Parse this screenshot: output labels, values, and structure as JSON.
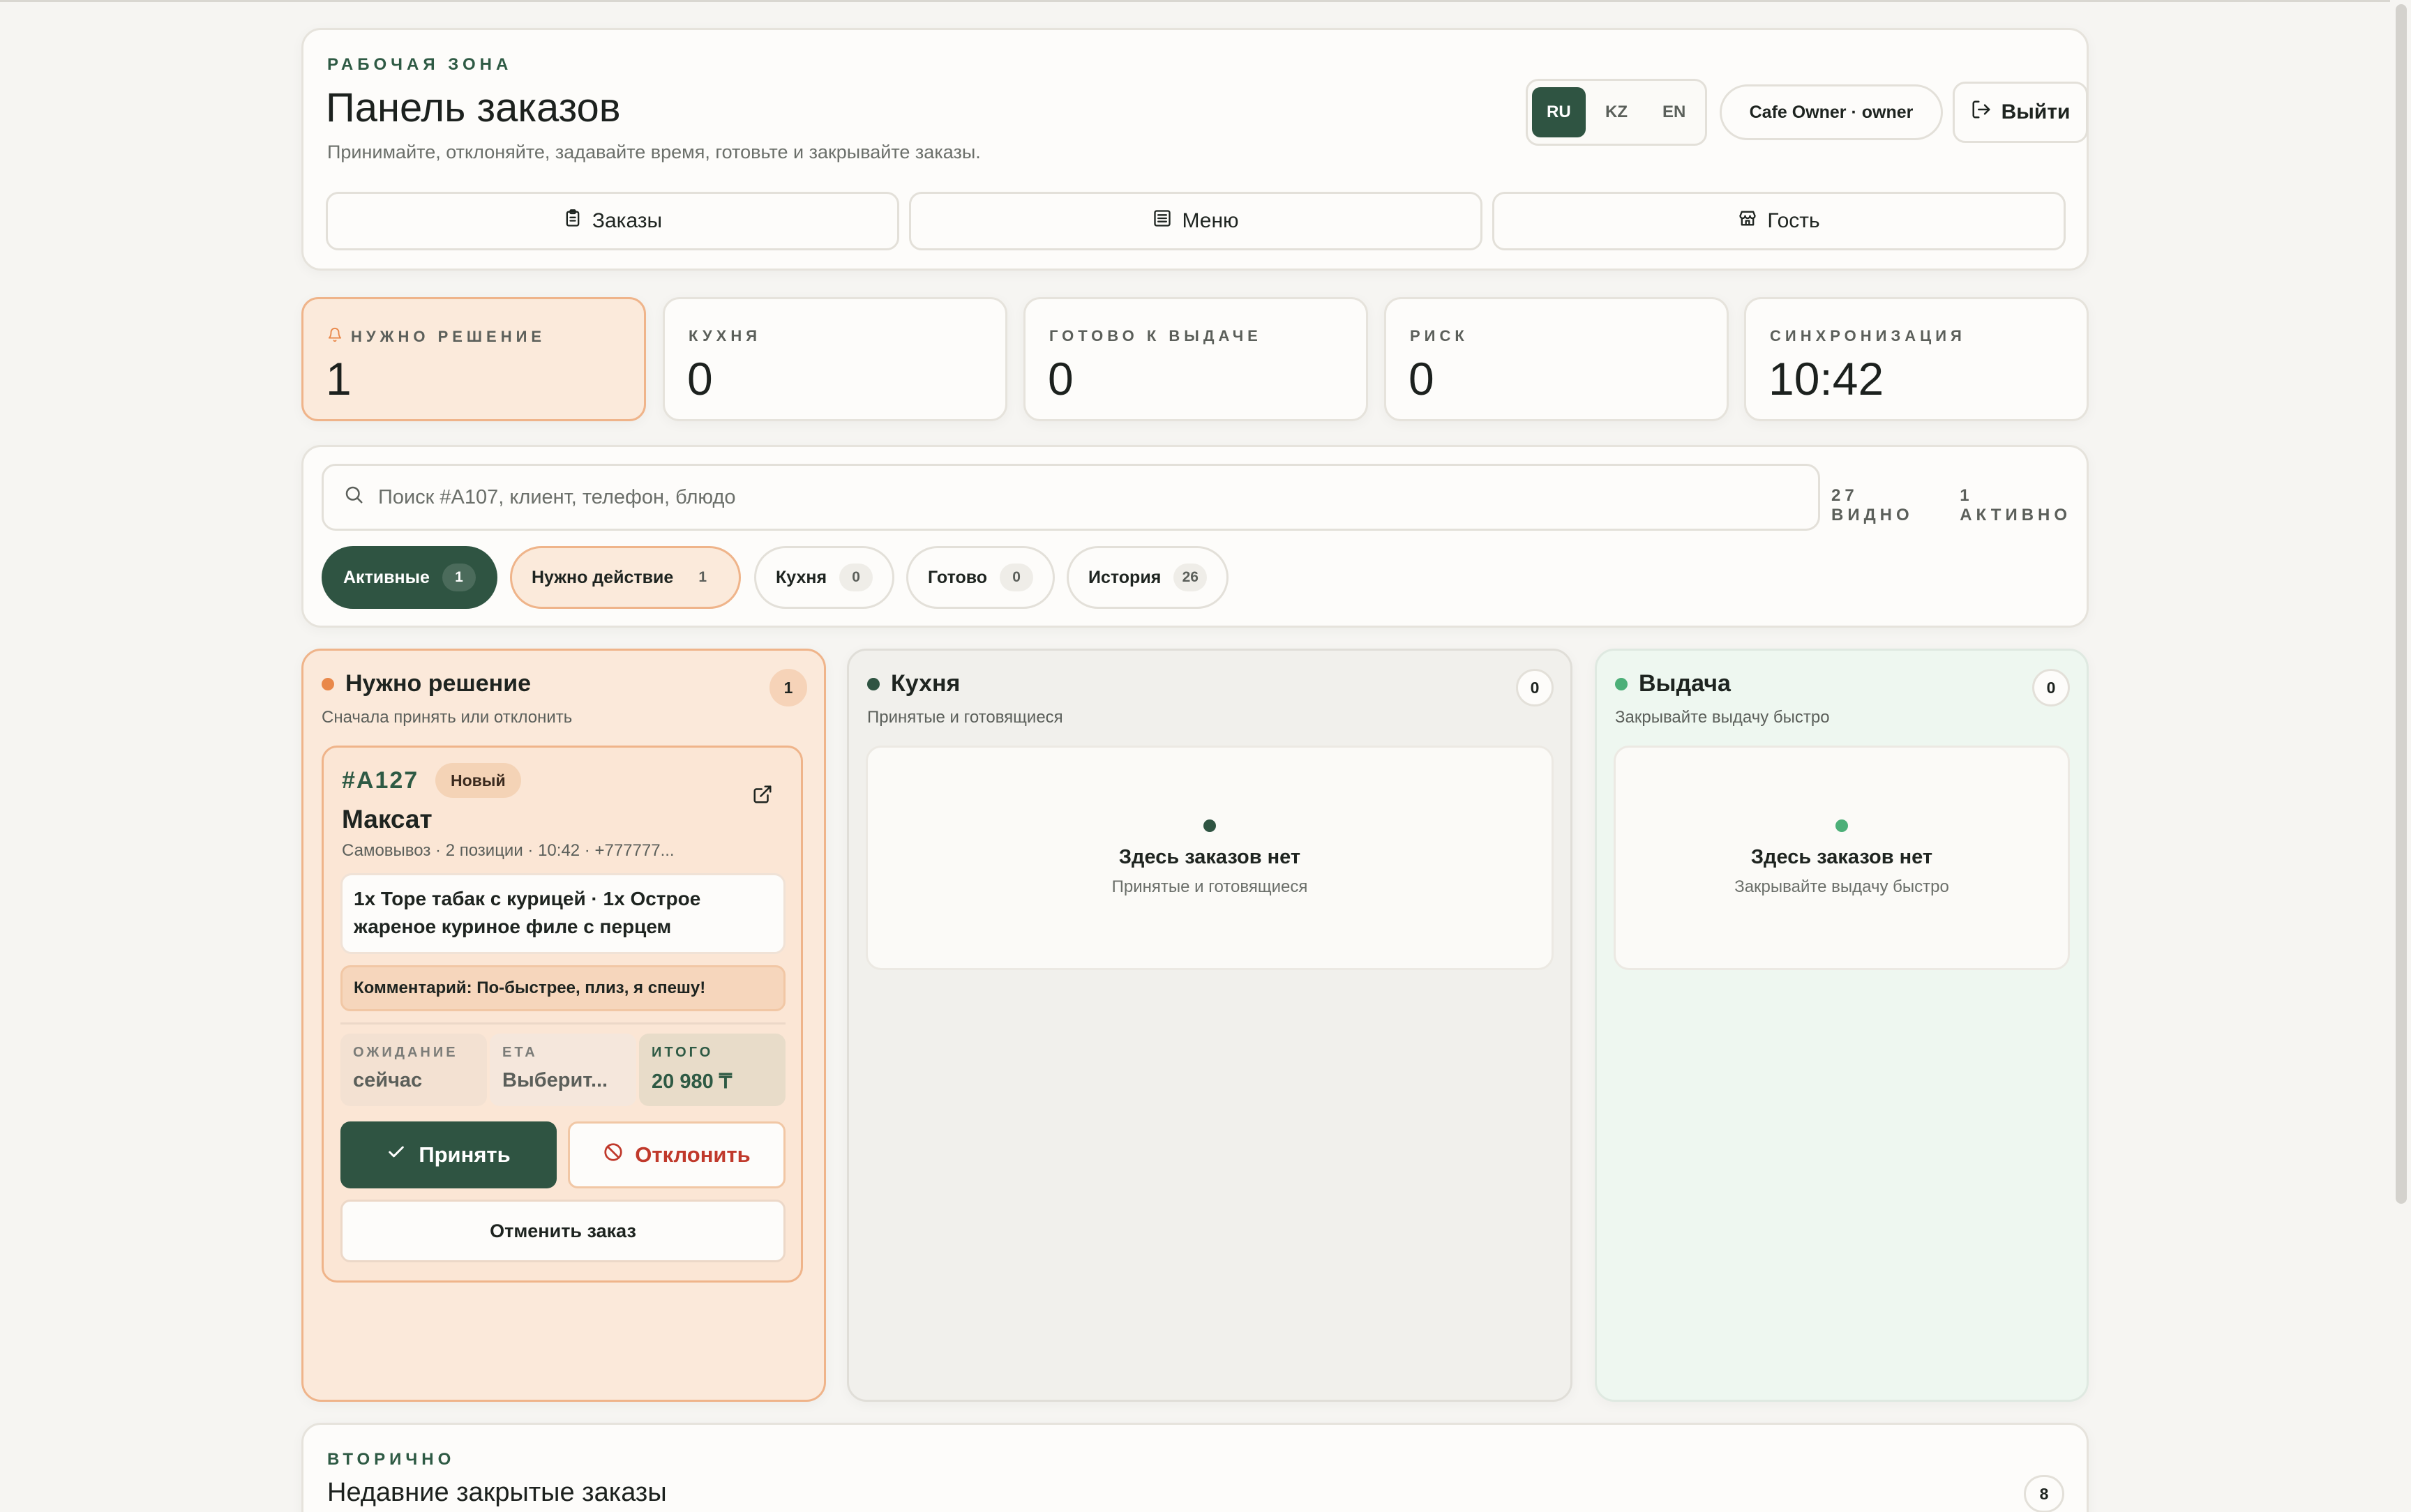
{
  "header": {
    "kicker": "РАБОЧАЯ ЗОНА",
    "title": "Панель заказов",
    "subtitle": "Принимайте, отклоняйте, задавайте время, готовьте и закрывайте заказы.",
    "languages": [
      "RU",
      "KZ",
      "EN"
    ],
    "active_language": "RU",
    "user": "Cafe Owner · owner",
    "logout_label": "Выйти",
    "nav": [
      {
        "label": "Заказы",
        "icon": "clipboard-icon"
      },
      {
        "label": "Меню",
        "icon": "list-icon"
      },
      {
        "label": "Гость",
        "icon": "store-icon"
      }
    ]
  },
  "stats": [
    {
      "label": "НУЖНО РЕШЕНИЕ",
      "value": "1",
      "icon": "bell-icon",
      "highlight": true
    },
    {
      "label": "КУХНЯ",
      "value": "0"
    },
    {
      "label": "ГОТОВО К ВЫДАЧЕ",
      "value": "0"
    },
    {
      "label": "РИСК",
      "value": "0"
    },
    {
      "label": "СИНХРОНИЗАЦИЯ",
      "value": "10:42"
    }
  ],
  "filters": {
    "search_placeholder": "Поиск #A107, клиент, телефон, блюдо",
    "visible_count": "27 ВИДНО",
    "active_count": "1 АКТИВНО",
    "chips": [
      {
        "label": "Активные",
        "count": "1",
        "state": "active"
      },
      {
        "label": "Нужно действие",
        "count": "1",
        "state": "warn"
      },
      {
        "label": "Кухня",
        "count": "0",
        "state": "normal"
      },
      {
        "label": "Готово",
        "count": "0",
        "state": "normal"
      },
      {
        "label": "История",
        "count": "26",
        "state": "normal"
      }
    ]
  },
  "columns": {
    "decision": {
      "title": "Нужно решение",
      "subtitle": "Сначала принять или отклонить",
      "count": "1",
      "dot_color": "#e9884a",
      "order": {
        "id": "#A127",
        "status": "Новый",
        "customer": "Максат",
        "meta": "Самовывоз · 2 позиции · 10:42 · +777777...",
        "items": "1x Торе табак с курицей · 1x Острое жареное куриное филе с перцем",
        "comment": "Комментарий: По-быстрее, плиз, я спешу!",
        "wait_label": "ОЖИДАНИЕ",
        "wait_value": "сейчас",
        "eta_label": "ЕТА",
        "eta_value": "Выберит...",
        "total_label": "ИТОГО",
        "total_value": "20 980 ₸",
        "accept_label": "Принять",
        "reject_label": "Отклонить",
        "cancel_label": "Отменить заказ"
      }
    },
    "kitchen": {
      "title": "Кухня",
      "subtitle": "Принятые и готовящиеся",
      "count": "0",
      "dot_color": "#2f5442",
      "empty_title": "Здесь заказов нет",
      "empty_sub": "Принятые и готовящиеся"
    },
    "pickup": {
      "title": "Выдача",
      "subtitle": "Закрывайте выдачу быстро",
      "count": "0",
      "dot_color": "#4caf78",
      "empty_title": "Здесь заказов нет",
      "empty_sub": "Закрывайте выдачу быстро"
    }
  },
  "recent": {
    "kicker": "ВТОРИЧНО",
    "title": "Недавние закрытые заказы",
    "count": "8"
  },
  "colors": {
    "accent": "#2f5442",
    "warning_bg": "#fbeadb",
    "warning_border": "#efb48a",
    "danger": "#c0392b",
    "background": "#f6f5f2"
  }
}
